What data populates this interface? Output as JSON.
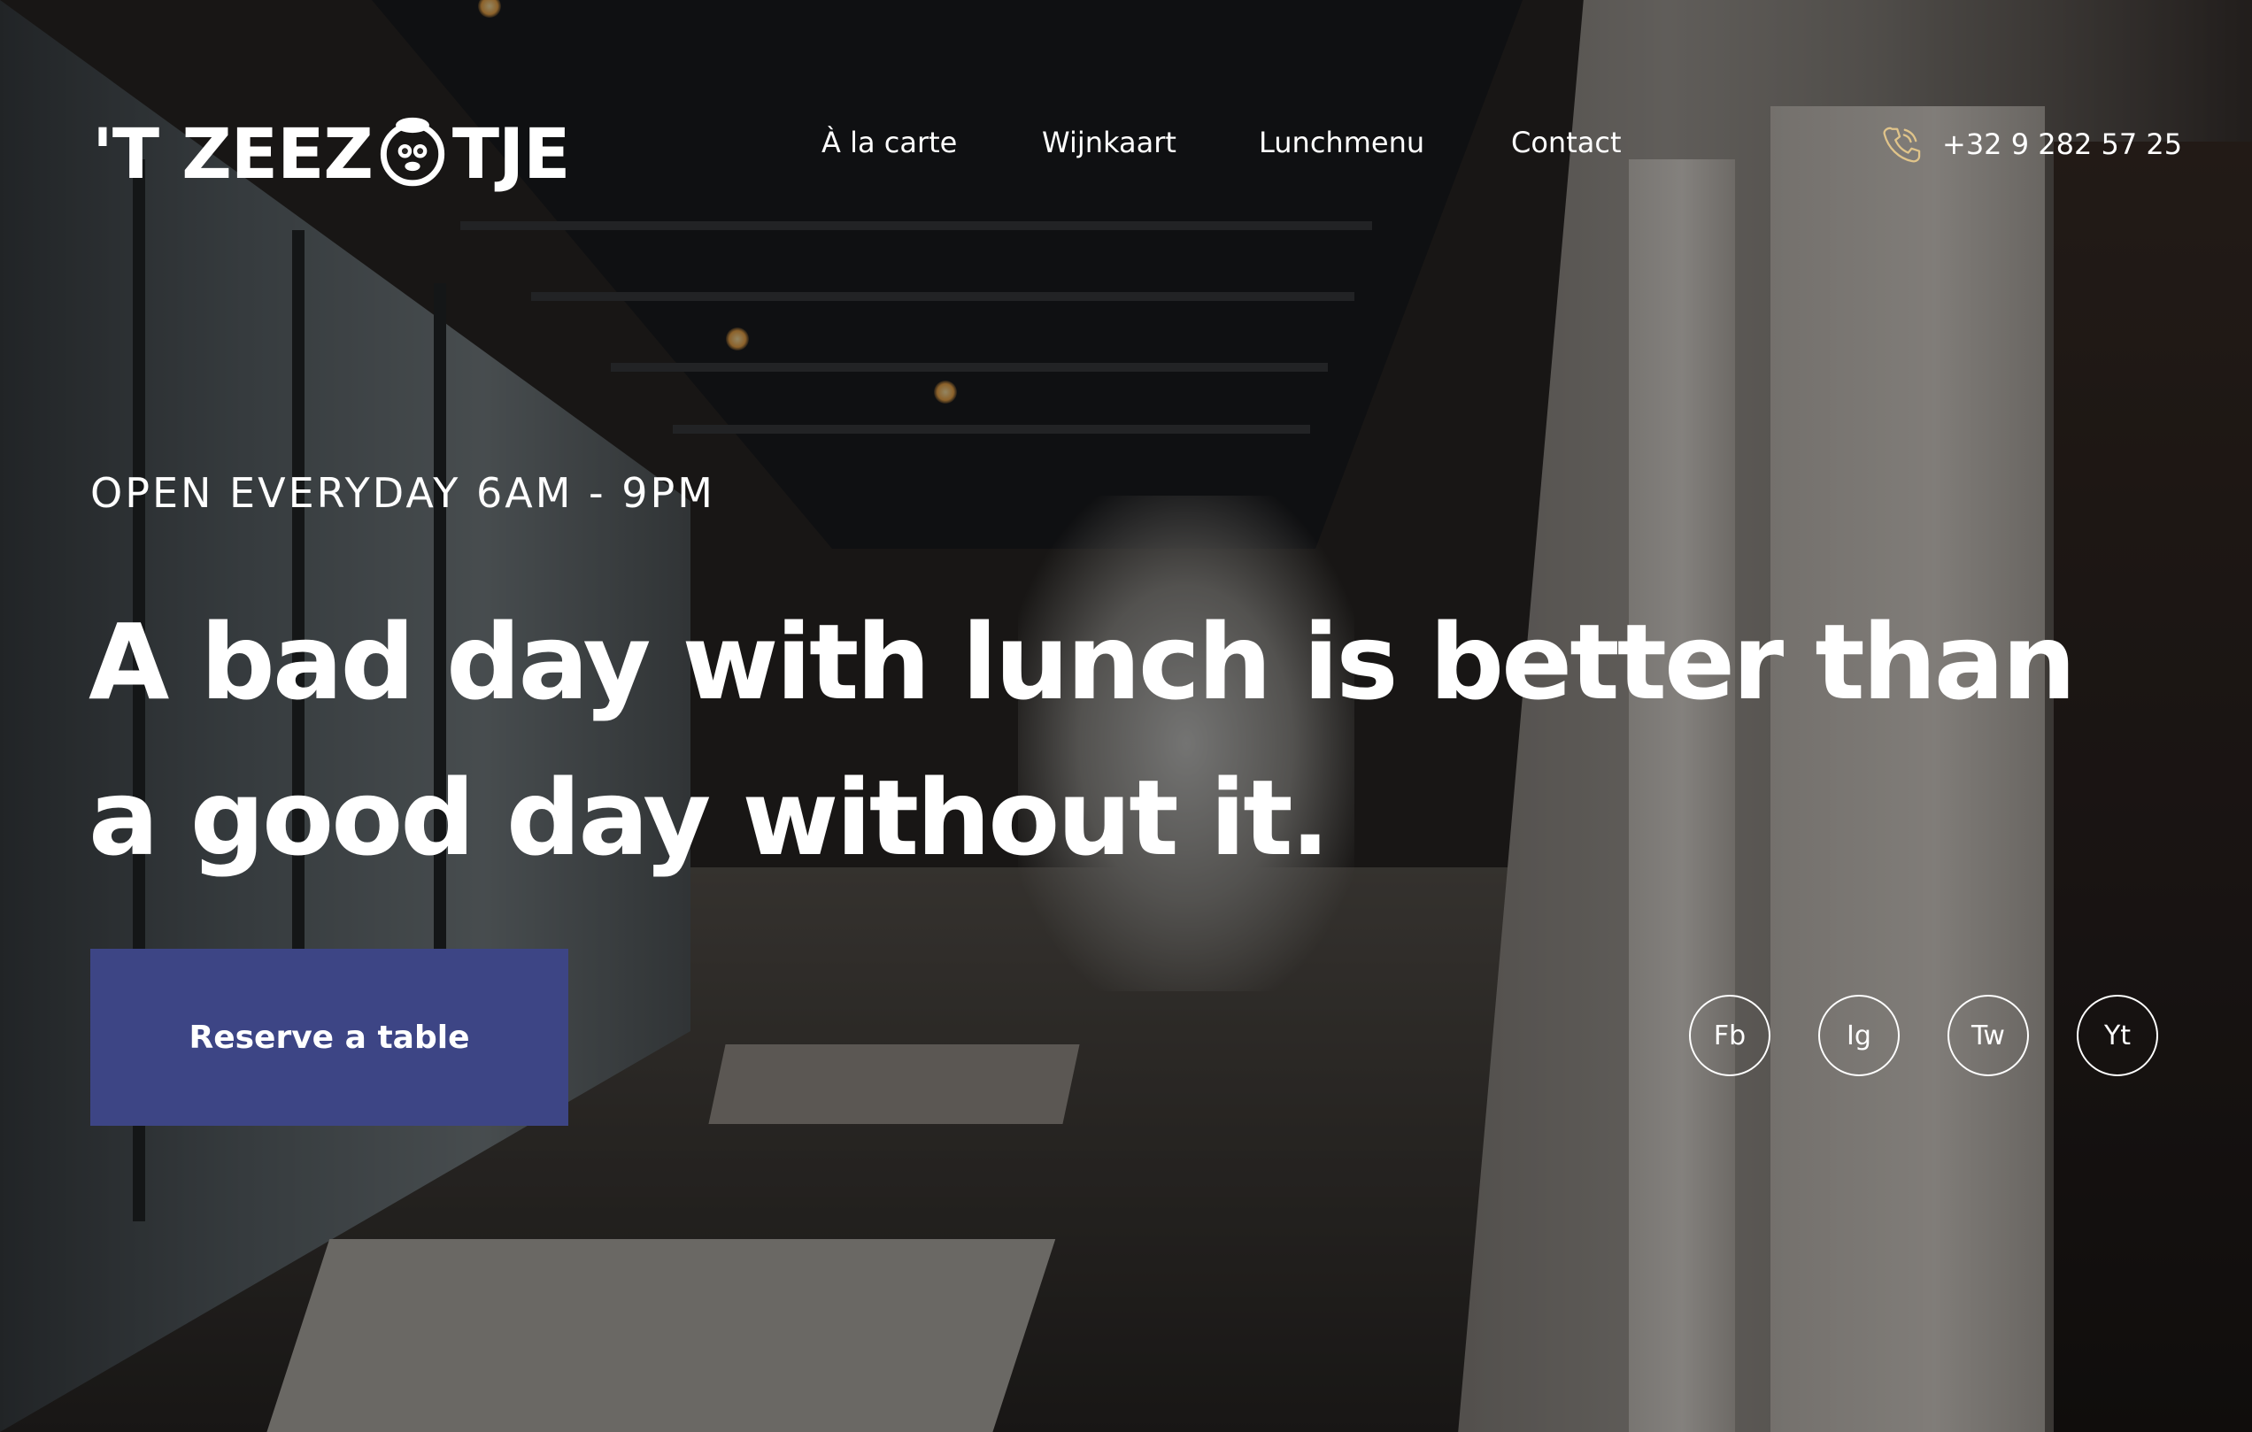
{
  "brand": {
    "logo_left": "'T ZEEZ",
    "logo_right": "TJE"
  },
  "nav": {
    "items": [
      {
        "label": "À la carte"
      },
      {
        "label": "Wijnkaart"
      },
      {
        "label": "Lunchmenu"
      },
      {
        "label": "Contact"
      }
    ]
  },
  "contact": {
    "phone": "+32 9 282 57 25",
    "icon": "phone-icon"
  },
  "hero": {
    "kicker": "OPEN EVERYDAY 6AM - 9PM",
    "headline_line1": "A bad day with lunch is better than",
    "headline_line2": "a good day without it.",
    "cta_label": "Reserve a table",
    "cta_color": "#3d4585"
  },
  "socials": [
    {
      "label": "Fb"
    },
    {
      "label": "Ig"
    },
    {
      "label": "Tw"
    },
    {
      "label": "Yt"
    }
  ]
}
